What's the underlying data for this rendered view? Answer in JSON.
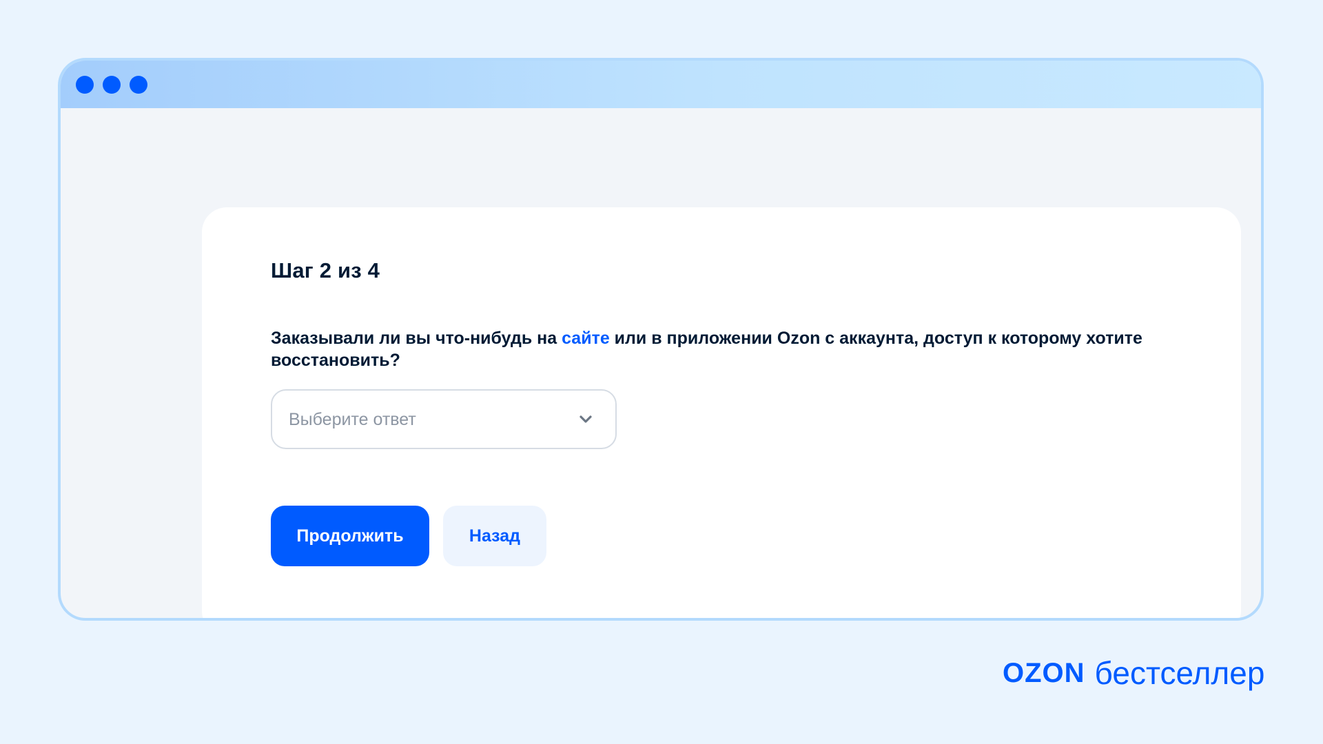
{
  "window": {
    "controls": [
      "dot",
      "dot",
      "dot"
    ]
  },
  "form": {
    "step_title": "Шаг 2 из 4",
    "question_part1": "Заказывали ли вы что-нибудь на ",
    "question_link": "сайте",
    "question_part2": " или в приложении Ozon с аккаунта, доступ к которому хотите восстановить?",
    "select_placeholder": "Выберите ответ",
    "continue_label": "Продолжить",
    "back_label": "Назад"
  },
  "brand": {
    "logo": "OZON",
    "text": "бестселлер"
  },
  "colors": {
    "accent": "#005bff",
    "page_background": "#eaf4fe",
    "window_background": "#f2f5f9",
    "card_background": "#ffffff",
    "text_primary": "#001a34",
    "placeholder": "#8d96a3",
    "secondary_button": "#edf4fe"
  },
  "icons": {
    "select_chevron": "chevron-down-icon",
    "window_dot": "window-dot-icon"
  }
}
